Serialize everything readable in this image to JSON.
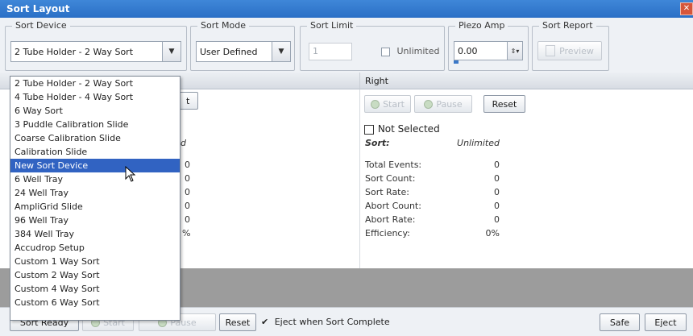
{
  "window": {
    "title": "Sort Layout"
  },
  "sort_device": {
    "legend": "Sort Device",
    "value": "2 Tube Holder - 2 Way Sort",
    "options": [
      "2 Tube Holder - 2 Way Sort",
      "4 Tube Holder - 4 Way Sort",
      "6 Way Sort",
      "3 Puddle Calibration Slide",
      "Coarse Calibration Slide",
      "Calibration Slide",
      "New Sort Device",
      "6 Well Tray",
      "24 Well Tray",
      "AmpliGrid Slide",
      "96 Well Tray",
      "384 Well Tray",
      "Accudrop Setup",
      "Custom 1 Way Sort",
      "Custom 2 Way Sort",
      "Custom 4 Way Sort",
      "Custom 6 Way Sort"
    ],
    "highlighted": "New Sort Device"
  },
  "sort_mode": {
    "legend": "Sort Mode",
    "value": "User Defined"
  },
  "sort_limit": {
    "legend": "Sort Limit",
    "value": "1",
    "unlimited_label": "Unlimited"
  },
  "piezo_amp": {
    "legend": "Piezo Amp",
    "value": "0.00"
  },
  "sort_report": {
    "legend": "Sort Report",
    "preview_label": "Preview"
  },
  "left_panel": {
    "partial_values": [
      "0",
      "0",
      "0",
      "0",
      "0",
      "%"
    ],
    "partial_button": "t",
    "partial_sort_value": "d"
  },
  "right_panel": {
    "header": "Right",
    "start_label": "Start",
    "pause_label": "Pause",
    "reset_label": "Reset",
    "not_selected_label": "Not Selected",
    "sort_label": "Sort:",
    "sort_value": "Unlimited",
    "stats": [
      {
        "label": "Total Events:",
        "value": "0"
      },
      {
        "label": "Sort Count:",
        "value": "0"
      },
      {
        "label": "Sort Rate:",
        "value": "0"
      },
      {
        "label": "Abort Count:",
        "value": "0"
      },
      {
        "label": "Abort Rate:",
        "value": "0"
      },
      {
        "label": "Efficiency:",
        "value": "0%"
      }
    ]
  },
  "bottom": {
    "sort_ready_label": "Sort Ready",
    "start_label": "Start",
    "pause_label": "Pause",
    "reset_label": "Reset",
    "eject_when_complete_label": "Eject when Sort Complete",
    "safe_label": "Safe",
    "eject_label": "Eject"
  }
}
